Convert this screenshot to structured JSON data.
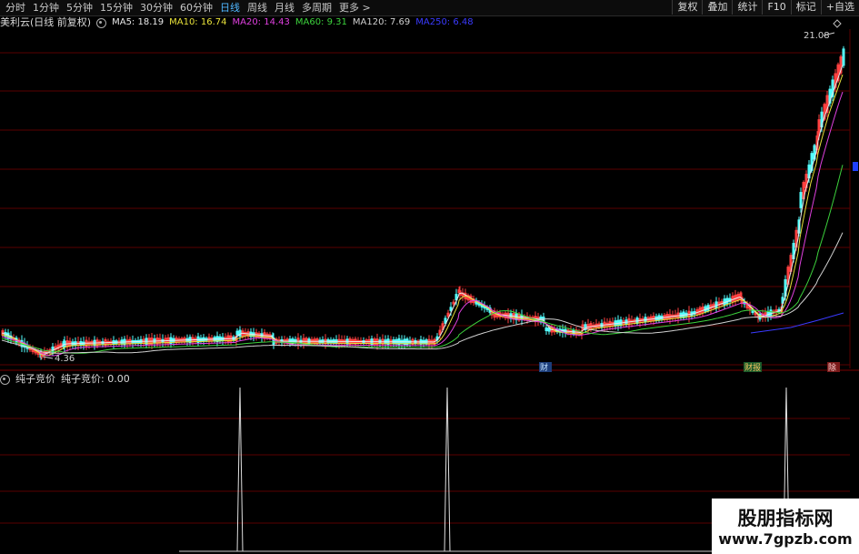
{
  "toolbar": {
    "periods": [
      "分时",
      "1分钟",
      "5分钟",
      "15分钟",
      "30分钟",
      "60分钟",
      "日线",
      "周线",
      "月线",
      "多周期",
      "更多 >"
    ],
    "active_period": "日线",
    "right_tools": [
      "复权",
      "叠加",
      "统计",
      "F10",
      "标记",
      "+自选"
    ]
  },
  "stock": {
    "name": "美利云(日线 前复权)",
    "ma": [
      {
        "label": "MA5: 18.19",
        "color": "#e8e8e8"
      },
      {
        "label": "MA10: 16.74",
        "color": "#e8e23a"
      },
      {
        "label": "MA20: 14.43",
        "color": "#e040e0"
      },
      {
        "label": "MA60: 9.31",
        "color": "#3cd23c"
      },
      {
        "label": "MA120: 7.69",
        "color": "#d0d0d0"
      },
      {
        "label": "MA250: 6.48",
        "color": "#3a3aff"
      }
    ],
    "high_mark": "21.08",
    "low_mark": "4.36",
    "event_tags": [
      "财",
      "财报",
      "除"
    ]
  },
  "indicator": {
    "name": "纯子竞价",
    "value_label": "纯子竞价: 0.00",
    "spikes_at": [
      264,
      492,
      865
    ]
  },
  "watermark": {
    "title": "股朋指标网",
    "url": "www.7gpzb.com"
  },
  "colors": {
    "up": "#ff4040",
    "down": "#54ffff",
    "grid": "#5a0000",
    "active": "#4fb6ff"
  }
}
